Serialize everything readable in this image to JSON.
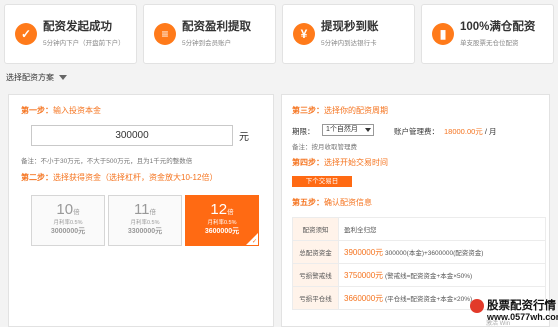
{
  "features": [
    {
      "title": "配资发起成功",
      "sub": "5分钟内下户（开盘前下户）",
      "icon": "check-clock-icon",
      "glyph": "✓"
    },
    {
      "title": "配资盈利提取",
      "sub": "5分钟到会员账户",
      "icon": "sliders-icon",
      "glyph": "≡"
    },
    {
      "title": "提现秒到账",
      "sub": "5分钟内到达银行卡",
      "icon": "yen-icon",
      "glyph": "¥"
    },
    {
      "title": "100%满仓配资",
      "sub": "单支股票无仓位配资",
      "icon": "bar-chart-icon",
      "glyph": "▮"
    }
  ],
  "plan_label": "选择配资方案",
  "left": {
    "step1": {
      "prefix": "第一步：",
      "text": "输入投资本金"
    },
    "amount": "300000",
    "unit": "元",
    "note1": "备注：不小于30万元，不大于500万元，且为1千元的整数倍",
    "step2": {
      "prefix": "第二步：",
      "text": "选择获得资金（选择杠杆，资金放大10-12倍）"
    },
    "levers": [
      {
        "mult": "10",
        "suffix": "倍",
        "pct": "月利率0.5%",
        "total": "3000000元"
      },
      {
        "mult": "11",
        "suffix": "倍",
        "pct": "月利率0.5%",
        "total": "3300000元"
      },
      {
        "mult": "12",
        "suffix": "倍",
        "pct": "月利率0.5%",
        "total": "3600000元"
      }
    ],
    "check": "✓"
  },
  "right": {
    "step3": {
      "prefix": "第三步：",
      "text": "选择你的配资周期"
    },
    "period_label": "期限：",
    "period_value": "1个自然月",
    "fee_label": "账户管理费：",
    "fee_value": "18000.00元",
    "fee_unit": " / 月",
    "note": "备注：按月收取管理费",
    "step4": {
      "prefix": "第四步：",
      "text": "选择开始交易时间"
    },
    "next_button": "下个交易日",
    "step5": {
      "prefix": "第五步：",
      "text": "确认配资信息"
    },
    "rows": [
      {
        "key": "配资须知",
        "value": "",
        "detail": "盈利全归您"
      },
      {
        "key": "总配资资金",
        "value": "3900000元",
        "detail": "300000(本金)+3600000(配资资金)"
      },
      {
        "key": "亏损警戒线",
        "value": "3750000元",
        "detail": "(警戒线=配资资金+本金×50%)"
      },
      {
        "key": "亏损平仓线",
        "value": "3660000元",
        "detail": "(平仓线=配资资金+本金×20%)"
      }
    ]
  },
  "brand": {
    "title": "股票配资行情",
    "url": "www.0577wh.com"
  },
  "watermark": "激活 Win"
}
